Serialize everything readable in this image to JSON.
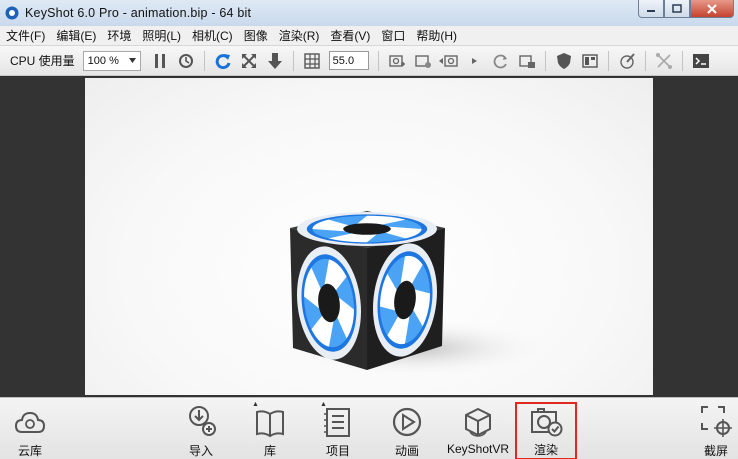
{
  "window": {
    "title": "KeyShot 6.0 Pro  - animation.bip  - 64 bit",
    "minimize_icon": "minimize-icon",
    "maximize_icon": "maximize-icon",
    "close_icon": "close-icon"
  },
  "menu": {
    "items": [
      "文件(F)",
      "编辑(E)",
      "环境",
      "照明(L)",
      "相机(C)",
      "图像",
      "渲染(R)",
      "查看(V)",
      "窗口",
      "帮助(H)"
    ]
  },
  "toolbar": {
    "cpu_label": "CPU 使用量",
    "zoom_value": "100 %",
    "fov_value": "55.0"
  },
  "ribbon": {
    "cloud_label": "云库",
    "import_label": "导入",
    "library_label": "库",
    "project_label": "项目",
    "animation_label": "动画",
    "keyshotvr_label": "KeyShotVR",
    "render_label": "渲染",
    "screenshot_label": "截屏"
  },
  "colors": {
    "highlight": "#e0281e",
    "accent_blue": "#1a73d9",
    "cube_dark": "#2b2b2b"
  }
}
